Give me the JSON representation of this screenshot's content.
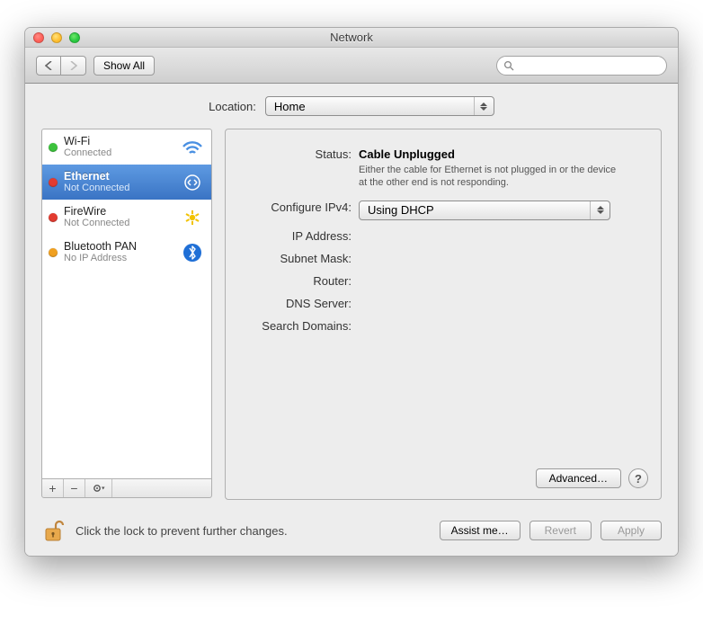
{
  "window": {
    "title": "Network"
  },
  "toolbar": {
    "show_all": "Show All",
    "search_placeholder": ""
  },
  "location": {
    "label": "Location:",
    "value": "Home"
  },
  "sidebar": {
    "items": [
      {
        "name": "Wi-Fi",
        "sub": "Connected",
        "dot": "#3cc23c",
        "selected": false
      },
      {
        "name": "Ethernet",
        "sub": "Not Connected",
        "dot": "#e23b30",
        "selected": true
      },
      {
        "name": "FireWire",
        "sub": "Not Connected",
        "dot": "#e23b30",
        "selected": false
      },
      {
        "name": "Bluetooth PAN",
        "sub": "No IP Address",
        "dot": "#f0a020",
        "selected": false
      }
    ]
  },
  "detail": {
    "status_label": "Status:",
    "status_value": "Cable Unplugged",
    "status_msg": "Either the cable for Ethernet is not plugged in or the device at the other end is not responding.",
    "configure_label": "Configure IPv4:",
    "configure_value": "Using DHCP",
    "ip_label": "IP Address:",
    "ip_value": "",
    "mask_label": "Subnet Mask:",
    "mask_value": "",
    "router_label": "Router:",
    "router_value": "",
    "dns_label": "DNS Server:",
    "dns_value": "",
    "search_label": "Search Domains:",
    "search_value": "",
    "advanced": "Advanced…"
  },
  "footer": {
    "lock_text": "Click the lock to prevent further changes.",
    "assist": "Assist me…",
    "revert": "Revert",
    "apply": "Apply"
  }
}
